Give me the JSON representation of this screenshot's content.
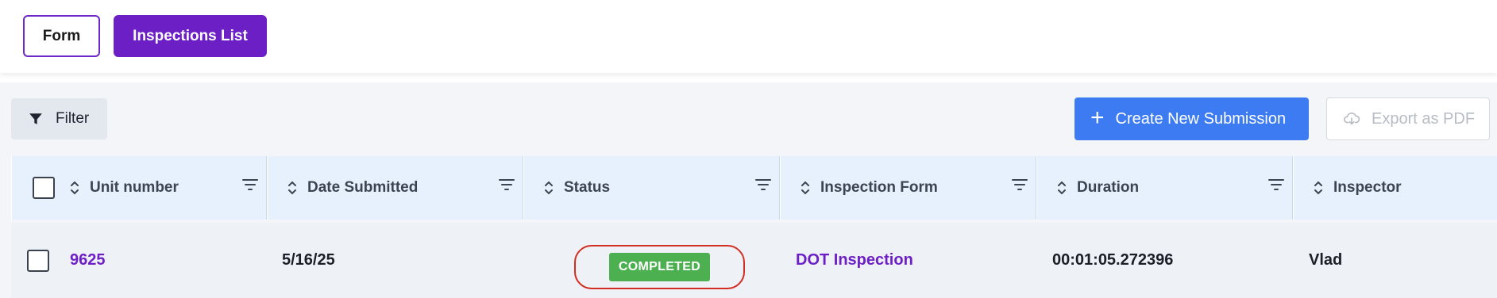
{
  "tabs": [
    {
      "label": "Form"
    },
    {
      "label": "Inspections List"
    }
  ],
  "toolbar": {
    "filter_label": "Filter",
    "create_label": "Create New Submission",
    "export_label": "Export as PDF"
  },
  "table": {
    "columns": [
      "Unit number",
      "Date Submitted",
      "Status",
      "Inspection Form",
      "Duration",
      "Inspector"
    ],
    "rows": [
      {
        "unit_number": "9625",
        "date_submitted": "5/16/25",
        "status": "COMPLETED",
        "inspection_form": "DOT Inspection",
        "duration": "00:01:05.272396",
        "inspector": "Vlad"
      }
    ]
  },
  "colors": {
    "primary_purple": "#6d1fc6",
    "create_blue": "#3d7bf2",
    "status_green": "#4caf50",
    "highlight_red": "#d32d22",
    "header_bg": "#e6f1fd"
  }
}
